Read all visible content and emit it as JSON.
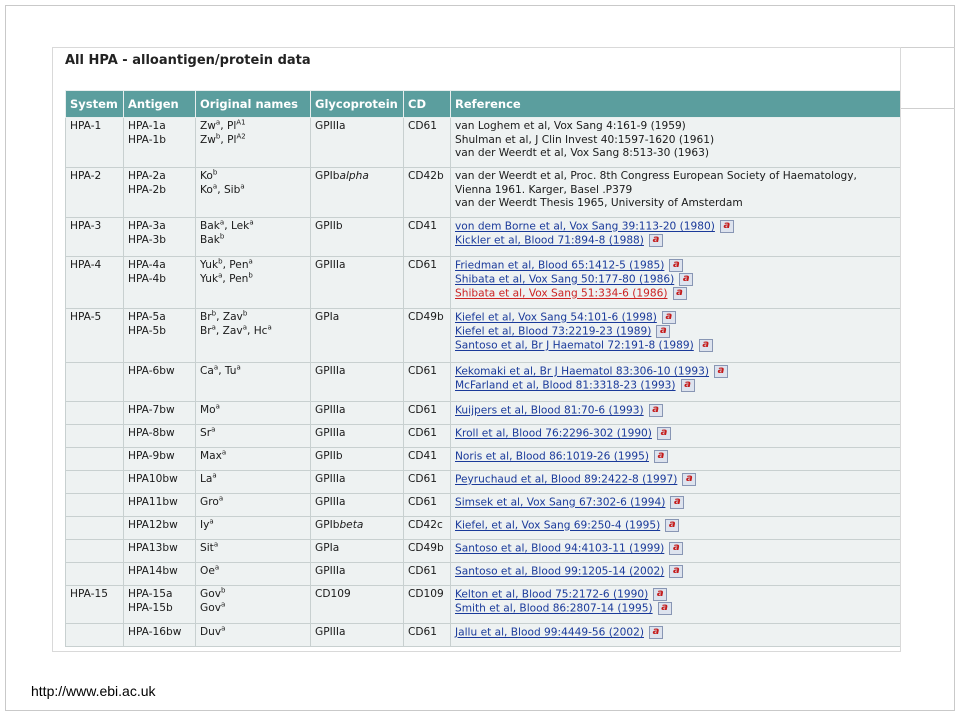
{
  "title": "All HPA - alloantigen/protein data",
  "columns": [
    "System",
    "Antigen",
    "Original names",
    "Glycoprotein",
    "CD",
    "Reference"
  ],
  "rows": [
    {
      "system": "HPA-1",
      "antigens": [
        "HPA-1a",
        "HPA-1b"
      ],
      "names": [
        {
          "a": "Zw",
          "a_sup": "a",
          "b": ", Pl",
          "b_sup": "A1"
        },
        {
          "a": "Zw",
          "a_sup": "b",
          "b": ", Pl",
          "b_sup": "A2"
        }
      ],
      "gp": "GPIIIa",
      "gp_italic": "",
      "cd": "CD61",
      "refs": [
        {
          "text": "van Loghem et al, Vox Sang 4:161-9 (1959)",
          "link": false
        },
        {
          "text": "Shulman et al, J Clin Invest 40:1597-1620 (1961)",
          "link": false
        },
        {
          "text": "van der Weerdt et al, Vox Sang 8:513-30 (1963)",
          "link": false
        }
      ]
    },
    {
      "system": "HPA-2",
      "antigens": [
        "HPA-2a",
        "HPA-2b"
      ],
      "names": [
        {
          "a": "Ko",
          "a_sup": "b",
          "b": "",
          "b_sup": ""
        },
        {
          "a": "Ko",
          "a_sup": "a",
          "b": ", Sib",
          "b_sup": "a"
        }
      ],
      "gp": "GPIb",
      "gp_italic": "alpha",
      "cd": "CD42b",
      "refs": [
        {
          "text": "van der Weerdt et al, Proc. 8th Congress European Society of Haematology,",
          "link": false
        },
        {
          "text": "Vienna 1961. Karger, Basel .P379",
          "link": false
        },
        {
          "text": "van der Weerdt Thesis 1965, University of Amsterdam",
          "link": false
        }
      ]
    },
    {
      "system": "HPA-3",
      "antigens": [
        "HPA-3a",
        "HPA-3b"
      ],
      "names": [
        {
          "a": "Bak",
          "a_sup": "a",
          "b": ", Lek",
          "b_sup": "a"
        },
        {
          "a": "Bak",
          "a_sup": "b",
          "b": "",
          "b_sup": ""
        }
      ],
      "gp": "GPIIb",
      "gp_italic": "",
      "cd": "CD41",
      "refs": [
        {
          "text": "von dem Borne et al, Vox Sang 39:113-20 (1980)",
          "link": true
        },
        {
          "text": "Kickler et al, Blood 71:894-8 (1988)",
          "link": true
        }
      ]
    },
    {
      "system": "HPA-4",
      "antigens": [
        "HPA-4a",
        "HPA-4b"
      ],
      "names": [
        {
          "a": "Yuk",
          "a_sup": "b",
          "b": ", Pen",
          "b_sup": "a"
        },
        {
          "a": "Yuk",
          "a_sup": "a",
          "b": ", Pen",
          "b_sup": "b"
        }
      ],
      "gp": "GPIIIa",
      "gp_italic": "",
      "cd": "CD61",
      "refs": [
        {
          "text": "Friedman et al, Blood 65:1412-5 (1985)",
          "link": true
        },
        {
          "text": "Shibata et al, Vox Sang 50:177-80 (1986)",
          "link": true
        },
        {
          "text": "Shibata et al, Vox Sang 51:334-6 (1986)",
          "link": true,
          "hl": true
        }
      ]
    },
    {
      "system": "HPA-5",
      "antigens": [
        "HPA-5a",
        "HPA-5b"
      ],
      "names": [
        {
          "a": "Br",
          "a_sup": "b",
          "b": ", Zav",
          "b_sup": "b"
        },
        {
          "a": "Br",
          "a_sup": "a",
          "b": ", Zav",
          "b_sup": "a",
          "c": ", Hc",
          "c_sup": "a"
        }
      ],
      "gp": "GPIa",
      "gp_italic": "",
      "cd": "CD49b",
      "refs": [
        {
          "text": "Kiefel et al, Vox Sang 54:101-6 (1998)",
          "link": true
        },
        {
          "text": "Kiefel et al, Blood 73:2219-23 (1989)",
          "link": true
        },
        {
          "text": "Santoso et al, Br J Haematol 72:191-8 (1989)",
          "link": true
        }
      ]
    },
    {
      "system": "",
      "antigens": [
        "HPA-6bw"
      ],
      "names": [
        {
          "a": "Ca",
          "a_sup": "a",
          "b": ", Tu",
          "b_sup": "a"
        }
      ],
      "gp": "GPIIIa",
      "gp_italic": "",
      "cd": "CD61",
      "refs": [
        {
          "text": "Kekomaki et al, Br J Haematol 83:306-10 (1993)",
          "link": true
        },
        {
          "text": "McFarland et al, Blood 81:3318-23 (1993)",
          "link": true
        }
      ]
    },
    {
      "system": "",
      "antigens": [
        "HPA-7bw"
      ],
      "names": [
        {
          "a": "Mo",
          "a_sup": "a",
          "b": "",
          "b_sup": ""
        }
      ],
      "gp": "GPIIIa",
      "gp_italic": "",
      "cd": "CD61",
      "refs": [
        {
          "text": "Kuijpers et al, Blood 81:70-6 (1993)",
          "link": true
        }
      ]
    },
    {
      "system": "",
      "antigens": [
        "HPA-8bw"
      ],
      "names": [
        {
          "a": "Sr",
          "a_sup": "a",
          "b": "",
          "b_sup": ""
        }
      ],
      "gp": "GPIIIa",
      "gp_italic": "",
      "cd": "CD61",
      "refs": [
        {
          "text": "Kroll et al, Blood 76:2296-302 (1990)",
          "link": true
        }
      ]
    },
    {
      "system": "",
      "antigens": [
        "HPA-9bw"
      ],
      "names": [
        {
          "a": "Max",
          "a_sup": "a",
          "b": "",
          "b_sup": ""
        }
      ],
      "gp": "GPIIb",
      "gp_italic": "",
      "cd": "CD41",
      "refs": [
        {
          "text": "Noris et al, Blood 86:1019-26 (1995)",
          "link": true
        }
      ]
    },
    {
      "system": "",
      "antigens": [
        "HPA10bw"
      ],
      "names": [
        {
          "a": "La",
          "a_sup": "a",
          "b": "",
          "b_sup": ""
        }
      ],
      "gp": "GPIIIa",
      "gp_italic": "",
      "cd": "CD61",
      "refs": [
        {
          "text": "Peyruchaud et al, Blood 89:2422-8 (1997)",
          "link": true
        }
      ]
    },
    {
      "system": "",
      "antigens": [
        "HPA11bw"
      ],
      "names": [
        {
          "a": "Gro",
          "a_sup": "a",
          "b": "",
          "b_sup": ""
        }
      ],
      "gp": "GPIIIa",
      "gp_italic": "",
      "cd": "CD61",
      "refs": [
        {
          "text": "Simsek et al, Vox Sang 67:302-6 (1994)",
          "link": true
        }
      ]
    },
    {
      "system": "",
      "antigens": [
        "HPA12bw"
      ],
      "names": [
        {
          "a": "Iy",
          "a_sup": "a",
          "b": "",
          "b_sup": ""
        }
      ],
      "gp": "GPIb",
      "gp_italic": "beta",
      "cd": "CD42c",
      "refs": [
        {
          "text": "Kiefel, et al, Vox Sang 69:250-4 (1995)",
          "link": true
        }
      ]
    },
    {
      "system": "",
      "antigens": [
        "HPA13bw"
      ],
      "names": [
        {
          "a": "Sit",
          "a_sup": "a",
          "b": "",
          "b_sup": ""
        }
      ],
      "gp": "GPIa",
      "gp_italic": "",
      "cd": "CD49b",
      "refs": [
        {
          "text": "Santoso et al, Blood 94:4103-11 (1999)",
          "link": true
        }
      ]
    },
    {
      "system": "",
      "antigens": [
        "HPA14bw"
      ],
      "names": [
        {
          "a": "Oe",
          "a_sup": "a",
          "b": "",
          "b_sup": ""
        }
      ],
      "gp": "GPIIIa",
      "gp_italic": "",
      "cd": "CD61",
      "refs": [
        {
          "text": "Santoso et al, Blood 99:1205-14 (2002)",
          "link": true
        }
      ]
    },
    {
      "system": "HPA-15",
      "antigens": [
        "HPA-15a",
        "HPA-15b"
      ],
      "names": [
        {
          "a": "Gov",
          "a_sup": "b",
          "b": "",
          "b_sup": ""
        },
        {
          "a": "Gov",
          "a_sup": "a",
          "b": "",
          "b_sup": ""
        }
      ],
      "gp": "CD109",
      "gp_italic": "",
      "cd": "CD109",
      "refs": [
        {
          "text": "Kelton et al, Blood 75:2172-6 (1990)",
          "link": true
        },
        {
          "text": "Smith et al, Blood 86:2807-14 (1995)",
          "link": true
        }
      ]
    },
    {
      "system": "",
      "antigens": [
        "HPA-16bw"
      ],
      "names": [
        {
          "a": "Duv",
          "a_sup": "a",
          "b": "",
          "b_sup": ""
        }
      ],
      "gp": "GPIIIa",
      "gp_italic": "",
      "cd": "CD61",
      "refs": [
        {
          "text": "Jallu et al, Blood 99:4449-56 (2002)",
          "link": true
        }
      ]
    }
  ],
  "icon": {
    "label": "a",
    "name": "abstract-icon"
  },
  "footer_url": "http://www.ebi.ac.uk"
}
